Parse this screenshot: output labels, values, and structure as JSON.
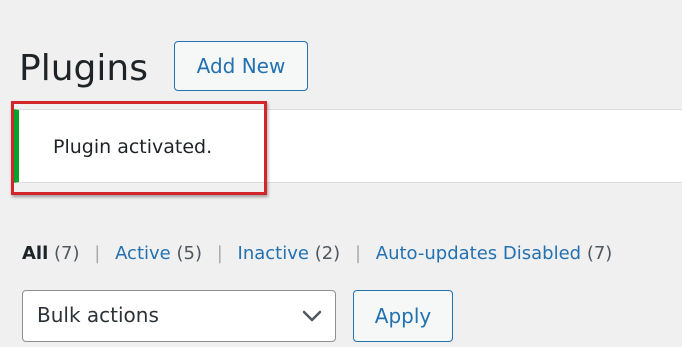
{
  "header": {
    "title": "Plugins",
    "add_new_label": "Add New"
  },
  "notice": {
    "message": "Plugin activated.",
    "accent_color": "#00a32a",
    "highlight_color": "#d3262b"
  },
  "filters": {
    "all_label": "All",
    "all_count": "(7)",
    "active_label": "Active",
    "active_count": "(5)",
    "inactive_label": "Inactive",
    "inactive_count": "(2)",
    "auto_updates_label": "Auto-updates Disabled",
    "auto_updates_count": "(7)",
    "separator": "|"
  },
  "bulk_actions": {
    "selected": "Bulk actions",
    "apply_label": "Apply",
    "icon": "chevron-down-icon"
  }
}
